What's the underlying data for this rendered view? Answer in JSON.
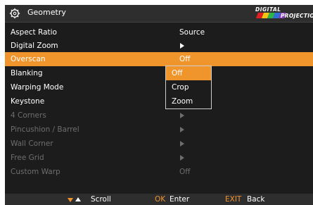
{
  "header": {
    "title": "Geometry",
    "icon": "geometry-icon",
    "logo_line1": "DIGITAL",
    "logo_line2": "PROJECTION"
  },
  "menu": {
    "items": [
      {
        "label": "Aspect Ratio",
        "value": "Source",
        "kind": "value",
        "enabled": true
      },
      {
        "label": "Digital Zoom",
        "value": "",
        "kind": "submenu",
        "enabled": true
      },
      {
        "label": "Overscan",
        "value": "Off",
        "kind": "value",
        "enabled": true,
        "selected": true
      },
      {
        "label": "Blanking",
        "value": "",
        "kind": "submenu",
        "enabled": true
      },
      {
        "label": "Warping Mode",
        "value": "",
        "kind": "value",
        "enabled": true
      },
      {
        "label": "Keystone",
        "value": "",
        "kind": "submenu",
        "enabled": true
      },
      {
        "label": "4 Corners",
        "value": "",
        "kind": "submenu",
        "enabled": false
      },
      {
        "label": "Pincushion / Barrel",
        "value": "",
        "kind": "submenu",
        "enabled": false
      },
      {
        "label": "Wall Corner",
        "value": "",
        "kind": "submenu",
        "enabled": false
      },
      {
        "label": "Free Grid",
        "value": "",
        "kind": "submenu",
        "enabled": false
      },
      {
        "label": "Custom Warp",
        "value": "Off",
        "kind": "value",
        "enabled": false
      }
    ]
  },
  "dropdown": {
    "options": [
      "Off",
      "Crop",
      "Zoom"
    ],
    "selected": "Off"
  },
  "footer": {
    "scroll_label": "Scroll",
    "ok_key": "OK",
    "ok_label": "Enter",
    "exit_key": "EXIT",
    "exit_label": "Back"
  },
  "colors": {
    "accent": "#f0952c",
    "background": "#1c1c1c",
    "bar": "#2e2e2e",
    "disabled_text": "#6e6e6e"
  }
}
